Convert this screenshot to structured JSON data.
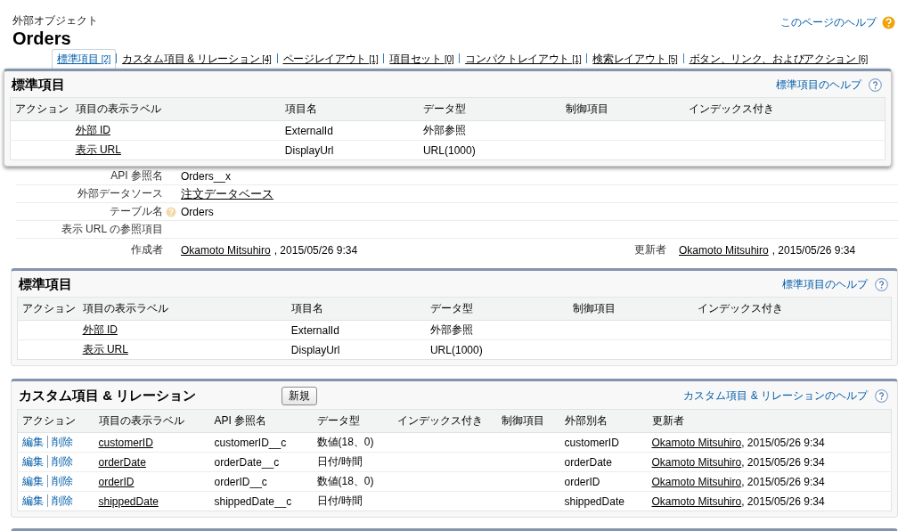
{
  "object_label": "外部オブジェクト",
  "title": "Orders",
  "page_help": "このページのヘルプ",
  "tabs": [
    {
      "label": "標準項目",
      "count": "[2]",
      "selected": true
    },
    {
      "label": "カスタム項目 & リレーション",
      "count": "[4]",
      "selected": false
    },
    {
      "label": "ページレイアウト",
      "count": "[1]",
      "selected": false
    },
    {
      "label": "項目セット",
      "count": "[0]",
      "selected": false
    },
    {
      "label": "コンパクトレイアウト",
      "count": "[1]",
      "selected": false
    },
    {
      "label": "検索レイアウト",
      "count": "[5]",
      "selected": false
    },
    {
      "label": "ボタン、リンク、およびアクション",
      "count": "[6]",
      "selected": false
    }
  ],
  "popup": {
    "title": "標準項目",
    "help": "標準項目のヘルプ",
    "columns": [
      "アクション",
      "項目の表示ラベル",
      "項目名",
      "データ型",
      "制御項目",
      "インデックス付き"
    ],
    "rows": [
      {
        "label": "外部 ID",
        "api_name": "ExternalId",
        "data_type": "外部参照"
      },
      {
        "label": "表示 URL",
        "api_name": "DisplayUrl",
        "data_type": "URL(1000)"
      }
    ]
  },
  "detail": {
    "rows": [
      {
        "kind": "text",
        "label": "API 参照名",
        "value": "Orders__x"
      },
      {
        "kind": "link",
        "label": "外部データソース",
        "value": "注文データベース"
      },
      {
        "kind": "help",
        "label": "テーブル名",
        "value": "Orders"
      },
      {
        "kind": "text",
        "label": "表示 URL の参照項目"
      }
    ],
    "created": {
      "label": "作成者",
      "user": "Okamoto Mitsuhiro",
      "date": ", 2015/05/26 9:34"
    },
    "modified": {
      "label": "更新者",
      "user": "Okamoto Mitsuhiro",
      "date": ", 2015/05/26 9:34"
    }
  },
  "standard": {
    "title": "標準項目",
    "help": "標準項目のヘルプ",
    "columns": [
      "アクション",
      "項目の表示ラベル",
      "項目名",
      "データ型",
      "制御項目",
      "インデックス付き"
    ],
    "rows": [
      {
        "label": "外部 ID",
        "api_name": "ExternalId",
        "data_type": "外部参照"
      },
      {
        "label": "表示 URL",
        "api_name": "DisplayUrl",
        "data_type": "URL(1000)"
      }
    ]
  },
  "custom": {
    "title": "カスタム項目 & リレーション",
    "new_button": "新規",
    "help": "カスタム項目 & リレーションのヘルプ",
    "columns": [
      "アクション",
      "項目の表示ラベル",
      "API 参照名",
      "データ型",
      "インデックス付き",
      "制御項目",
      "外部別名",
      "更新者"
    ],
    "rows": [
      {
        "edit": "編集",
        "delete": "削除",
        "label": "customerID",
        "api_name": "customerID__c",
        "data_type": "数値(18、0)",
        "external_name": "customerID",
        "user": "Okamoto Mitsuhiro",
        "date": ", 2015/05/26 9:34"
      },
      {
        "edit": "編集",
        "delete": "削除",
        "label": "orderDate",
        "api_name": "orderDate__c",
        "data_type": "日付/時間",
        "external_name": "orderDate",
        "user": "Okamoto Mitsuhiro",
        "date": ", 2015/05/26 9:34"
      },
      {
        "edit": "編集",
        "delete": "削除",
        "label": "orderID",
        "api_name": "orderID__c",
        "data_type": "数値(18、0)",
        "external_name": "orderID",
        "user": "Okamoto Mitsuhiro",
        "date": ", 2015/05/26 9:34"
      },
      {
        "edit": "編集",
        "delete": "削除",
        "label": "shippedDate",
        "api_name": "shippedDate__c",
        "data_type": "日付/時間",
        "external_name": "shippedDate",
        "user": "Okamoto Mitsuhiro",
        "date": ", 2015/05/26 9:34"
      }
    ]
  }
}
